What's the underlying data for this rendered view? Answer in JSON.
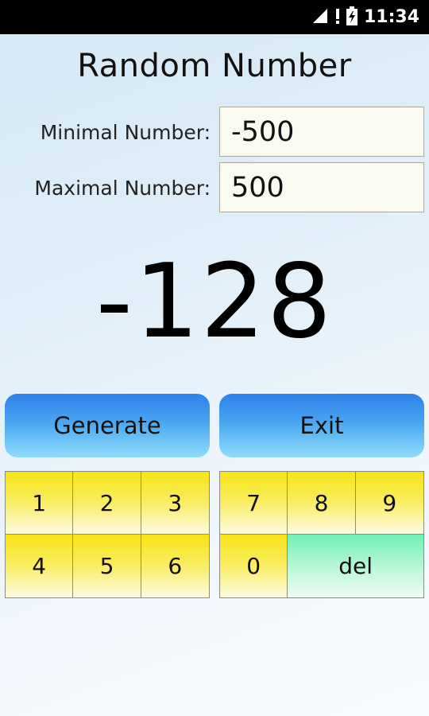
{
  "status_bar": {
    "time": "11:34",
    "icons": [
      "signal-icon",
      "alert-icon",
      "battery-charging-icon"
    ]
  },
  "app": {
    "title": "Random Number",
    "min_label": "Minimal Number:",
    "min_value": "-500",
    "max_label": "Maximal Number:",
    "max_value": "500",
    "result": "-128",
    "generate_label": "Generate",
    "exit_label": "Exit"
  },
  "keypad": {
    "left": [
      "1",
      "2",
      "3",
      "4",
      "5",
      "6"
    ],
    "right": [
      "7",
      "8",
      "9",
      "0"
    ],
    "del_label": "del"
  },
  "colors": {
    "status_bar": "#000000",
    "button_blue_top": "#2f80ea",
    "button_blue_bottom": "#8fdcfb",
    "key_yellow": "#f7e417",
    "key_green": "#6ef0b3",
    "input_bg": "#fafaf0"
  }
}
